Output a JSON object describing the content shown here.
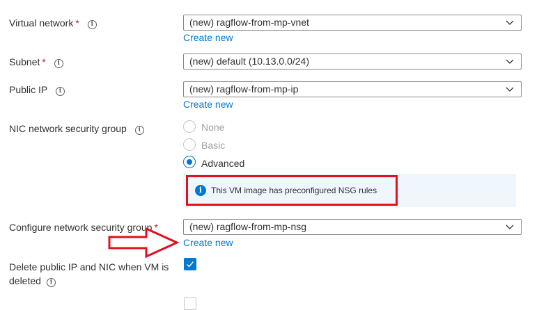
{
  "fields": {
    "virtual_network": {
      "label": "Virtual network",
      "required_mark": "*",
      "value": "(new) ragflow-from-mp-vnet",
      "create_new": "Create new"
    },
    "subnet": {
      "label": "Subnet",
      "required_mark": "*",
      "value": "(new) default (10.13.0.0/24)"
    },
    "public_ip": {
      "label": "Public IP",
      "value": "(new) ragflow-from-mp-ip",
      "create_new": "Create new"
    },
    "nic_nsg": {
      "label": "NIC network security group",
      "options": [
        {
          "label": "None",
          "selected": false,
          "disabled": true
        },
        {
          "label": "Basic",
          "selected": false,
          "disabled": true
        },
        {
          "label": "Advanced",
          "selected": true,
          "disabled": false
        }
      ],
      "info_message": "This VM image has preconfigured NSG rules"
    },
    "configure_nsg": {
      "label": "Configure network security group",
      "required_mark": "*",
      "value": "(new) ragflow-from-mp-nsg",
      "create_new": "Create new"
    },
    "delete_public_ip": {
      "label_line1": "Delete public IP and NIC when VM is",
      "label_line2": "deleted",
      "checked": true
    }
  },
  "annotations": {
    "highlight_color": "#e3101d",
    "arrow_color": "#e3101d"
  },
  "colors": {
    "accent": "#0078d4",
    "required": "#a4262c",
    "info_background": "#eff6fc"
  },
  "icons": {
    "info": "info-circle-icon",
    "chevron": "chevron-down-icon",
    "check": "checkmark-icon",
    "arrow": "right-arrow-icon"
  }
}
